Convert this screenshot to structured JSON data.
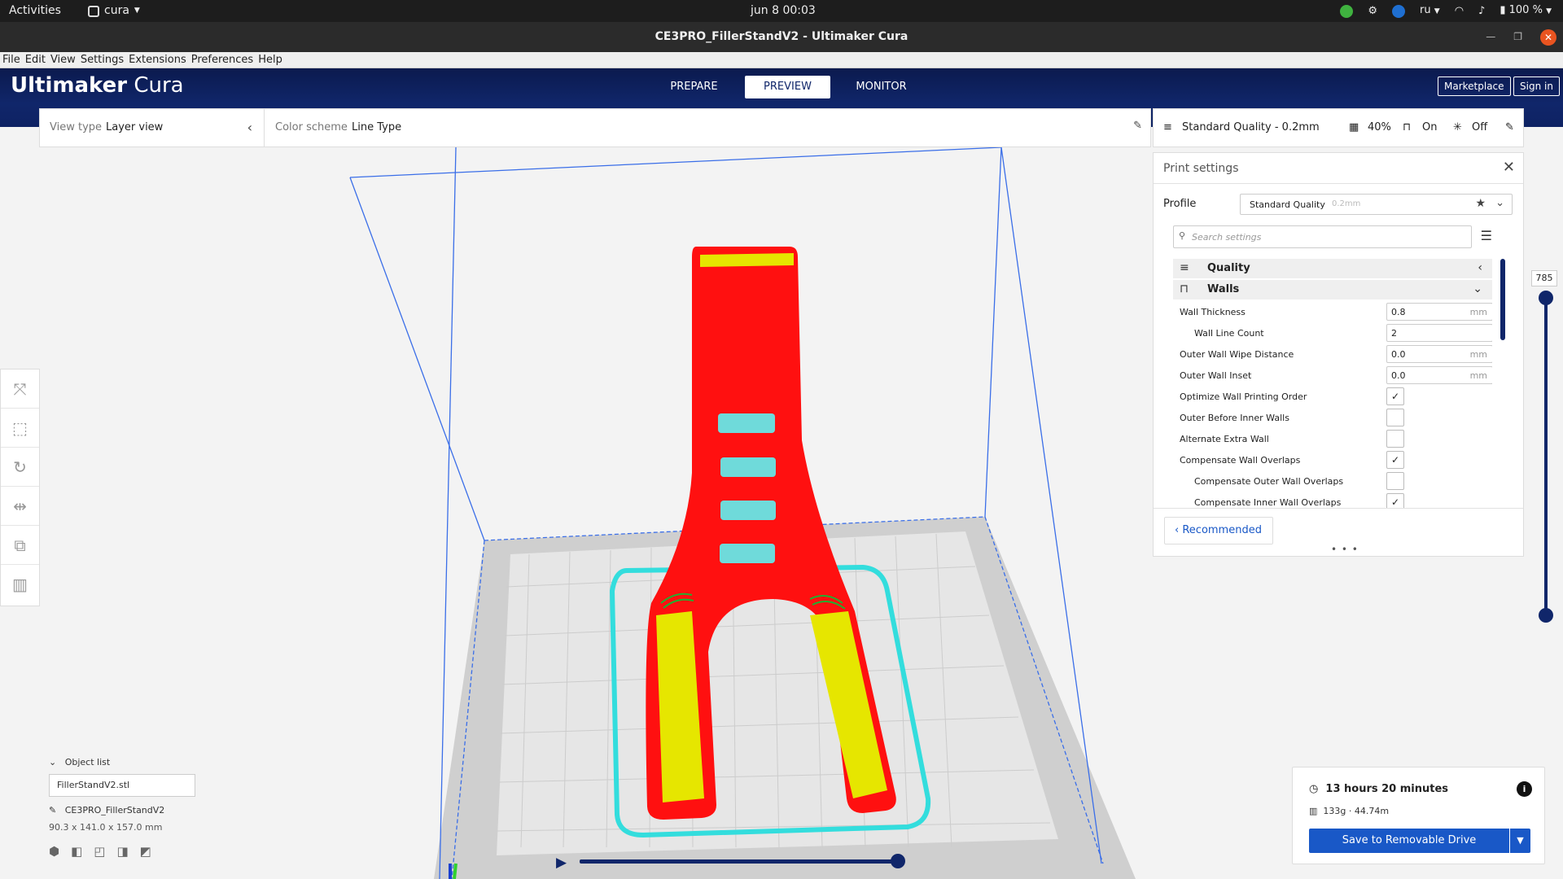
{
  "system": {
    "activities": "Activities",
    "app_name": "cura",
    "clock": "jun 8  00:03",
    "lang": "ru",
    "battery": "100 %"
  },
  "window": {
    "title": "CE3PRO_FillerStandV2 - Ultimaker Cura"
  },
  "menu": [
    "File",
    "Edit",
    "View",
    "Settings",
    "Extensions",
    "Preferences",
    "Help"
  ],
  "header": {
    "brand_bold": "Ultimaker",
    "brand_light": "Cura",
    "stages": [
      "PREPARE",
      "PREVIEW",
      "MONITOR"
    ],
    "active_stage": "PREVIEW",
    "marketplace": "Marketplace",
    "sign_in": "Sign in"
  },
  "viewbar": {
    "view_type_label": "View type",
    "view_type_value": "Layer view",
    "color_scheme_label": "Color scheme",
    "color_scheme_value": "Line Type"
  },
  "quality_bar": {
    "profile": "Standard Quality - 0.2mm",
    "infill": "40%",
    "support": "On",
    "adhesion": "Off"
  },
  "print_settings": {
    "title": "Print settings",
    "profile_label": "Profile",
    "profile_value": "Standard Quality",
    "profile_layer": "0.2mm",
    "search_placeholder": "Search settings",
    "categories": [
      {
        "name": "Quality",
        "icon": "quality-icon",
        "expanded": false
      },
      {
        "name": "Walls",
        "icon": "walls-icon",
        "expanded": true
      }
    ],
    "settings": [
      {
        "label": "Wall Thickness",
        "type": "number",
        "value": "0.8",
        "unit": "mm",
        "indent": false
      },
      {
        "label": "Wall Line Count",
        "type": "number",
        "value": "2",
        "unit": "",
        "indent": true
      },
      {
        "label": "Outer Wall Wipe Distance",
        "type": "number",
        "value": "0.0",
        "unit": "mm",
        "indent": false
      },
      {
        "label": "Outer Wall Inset",
        "type": "number",
        "value": "0.0",
        "unit": "mm",
        "indent": false
      },
      {
        "label": "Optimize Wall Printing Order",
        "type": "check",
        "checked": true,
        "indent": false
      },
      {
        "label": "Outer Before Inner Walls",
        "type": "check",
        "checked": false,
        "indent": false
      },
      {
        "label": "Alternate Extra Wall",
        "type": "check",
        "checked": false,
        "indent": false
      },
      {
        "label": "Compensate Wall Overlaps",
        "type": "check",
        "checked": true,
        "indent": false
      },
      {
        "label": "Compensate Outer Wall Overlaps",
        "type": "check",
        "checked": false,
        "indent": true
      },
      {
        "label": "Compensate Inner Wall Overlaps",
        "type": "check",
        "checked": true,
        "indent": true
      }
    ],
    "recommended": "Recommended"
  },
  "layer_slider": {
    "top_layer": "785"
  },
  "object_list": {
    "header": "Object list",
    "file": "FillerStandV2.stl",
    "project": "CE3PRO_FillerStandV2",
    "dimensions": "90.3 x 141.0 x 157.0 mm"
  },
  "output": {
    "time": "13 hours 20 minutes",
    "material": "133g · 44.74m",
    "save_button": "Save to Removable Drive"
  },
  "colors": {
    "brand_dark": "#10266a",
    "accent_blue": "#1958c7",
    "model_wall": "#ff1010",
    "model_infill": "#e6e600",
    "model_skirt": "#33dddd"
  }
}
